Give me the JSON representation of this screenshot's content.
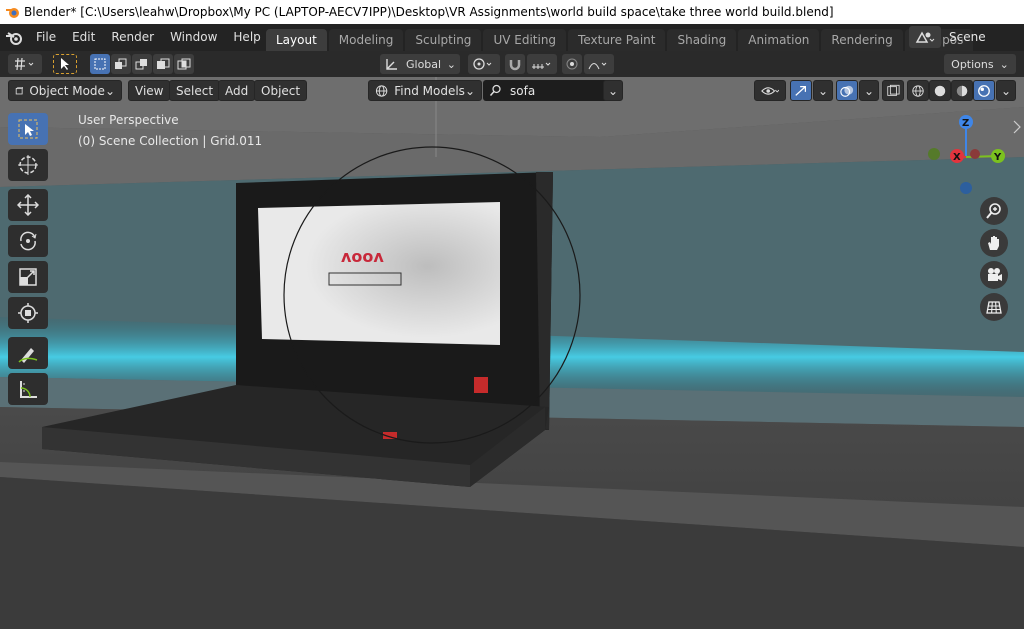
{
  "window": {
    "title": "Blender* [C:\\Users\\leahw\\Dropbox\\My PC (LAPTOP-AECV7IPP)\\Desktop\\VR Assignments\\world build space\\take three world build.blend]"
  },
  "menu": {
    "items": [
      "File",
      "Edit",
      "Render",
      "Window",
      "Help"
    ]
  },
  "workspaces": {
    "tabs": [
      "Layout",
      "Modeling",
      "Sculpting",
      "UV Editing",
      "Texture Paint",
      "Shading",
      "Animation",
      "Rendering",
      "Compos"
    ],
    "active": "Layout"
  },
  "scene": {
    "name": "Scene"
  },
  "toolheader": {
    "transform_orientation": "Global",
    "options_label": "Options"
  },
  "viewport_header": {
    "mode": "Object Mode",
    "view_label": "View",
    "select_label": "Select",
    "add_label": "Add",
    "object_label": "Object",
    "find_models_label": "Find Models",
    "search_value": "sofa"
  },
  "viewport": {
    "perspective_label": "User Perspective",
    "collection_label": "(0) Scene Collection | Grid.011",
    "axes": {
      "z": "Z",
      "x": "X",
      "y": "Y"
    },
    "screen_logo_text": "ʌooʌ"
  },
  "colors": {
    "accent": "#4772b3",
    "axis_x": "#e3343d",
    "axis_y": "#7bc11f",
    "axis_z": "#3f86e8",
    "floor_glow": "#3fd0ea"
  },
  "icons": {
    "tools": [
      "select-box-icon",
      "cursor-icon",
      "move-icon",
      "rotate-icon",
      "scale-icon",
      "transform-icon",
      "annotate-icon",
      "measure-icon"
    ],
    "nav": [
      "zoom-icon",
      "pan-hand-icon",
      "camera-icon",
      "grid-view-icon"
    ]
  }
}
